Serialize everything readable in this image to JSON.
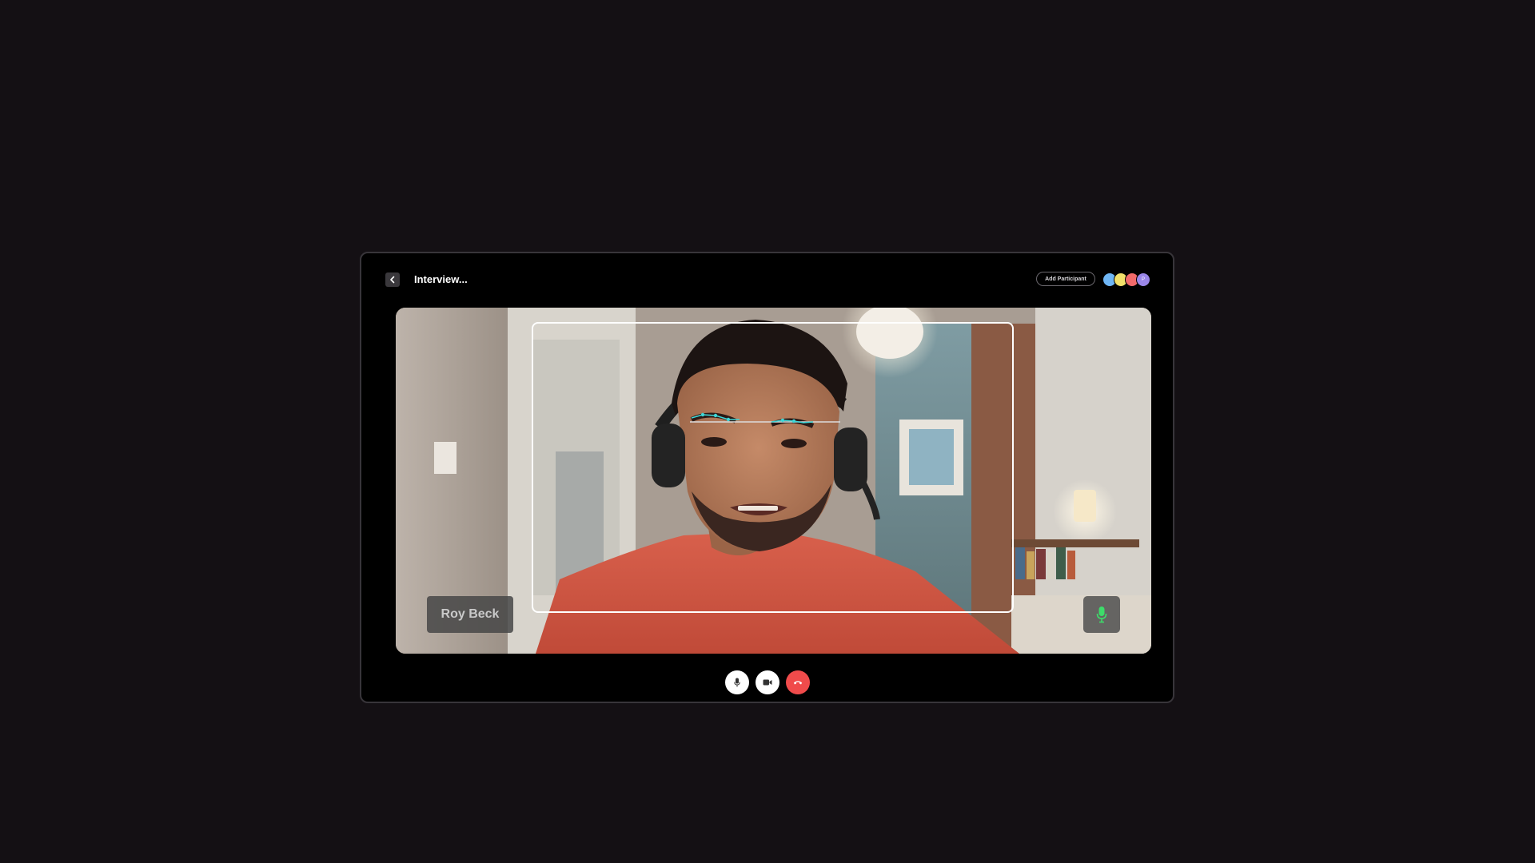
{
  "header": {
    "back_icon": "chevron-left-icon",
    "title": "Interview..."
  },
  "participants": {
    "add_label": "Add Participant",
    "avatars": [
      {
        "initial": "",
        "color": "#6fb6f5"
      },
      {
        "initial": "",
        "color": "#f2e06a"
      },
      {
        "initial": "",
        "color": "#f26a6a"
      },
      {
        "initial": "P",
        "color": "#9a86e8"
      }
    ]
  },
  "video": {
    "speaker_name": "Roy Beck",
    "mic_status_icon": "microphone-icon",
    "mic_active_color": "#3ddc6a",
    "face_detection": "face-frame-box",
    "landmark_color": "#3fd6d6"
  },
  "controls": {
    "mute_icon": "microphone-icon",
    "camera_icon": "video-camera-icon",
    "end_call_icon": "hang-up-icon",
    "end_call_color": "#f04b4b"
  }
}
